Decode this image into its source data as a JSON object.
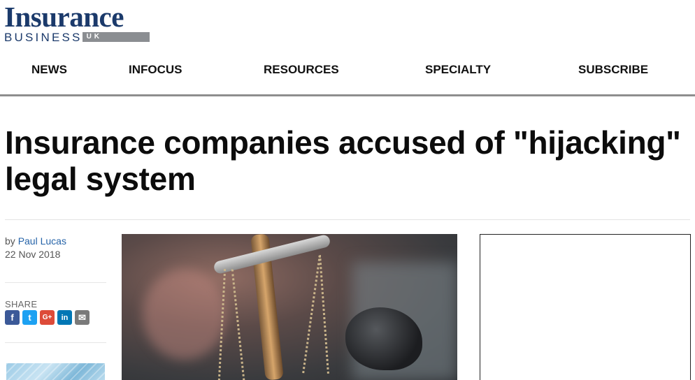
{
  "logo": {
    "main": "Insurance",
    "sub": "BUSINESS",
    "region": "UK"
  },
  "nav": {
    "items": [
      "NEWS",
      "INFOCUS",
      "RESOURCES",
      "SPECIALTY",
      "SUBSCRIBE"
    ]
  },
  "article": {
    "headline": "Insurance companies accused of \"hijacking\" legal system",
    "byline_prefix": "by",
    "author": "Paul Lucas",
    "date": "22 Nov 2018"
  },
  "share": {
    "label": "SHARE",
    "icons": [
      "facebook-icon",
      "twitter-icon",
      "google-plus-icon",
      "linkedin-icon",
      "email-icon"
    ],
    "glyphs": [
      "f",
      "t",
      "G+",
      "in",
      "✉"
    ]
  },
  "colors": {
    "brand": "#1b3a6b",
    "link": "#2563a8",
    "nav_border": "#8e8e8e"
  }
}
